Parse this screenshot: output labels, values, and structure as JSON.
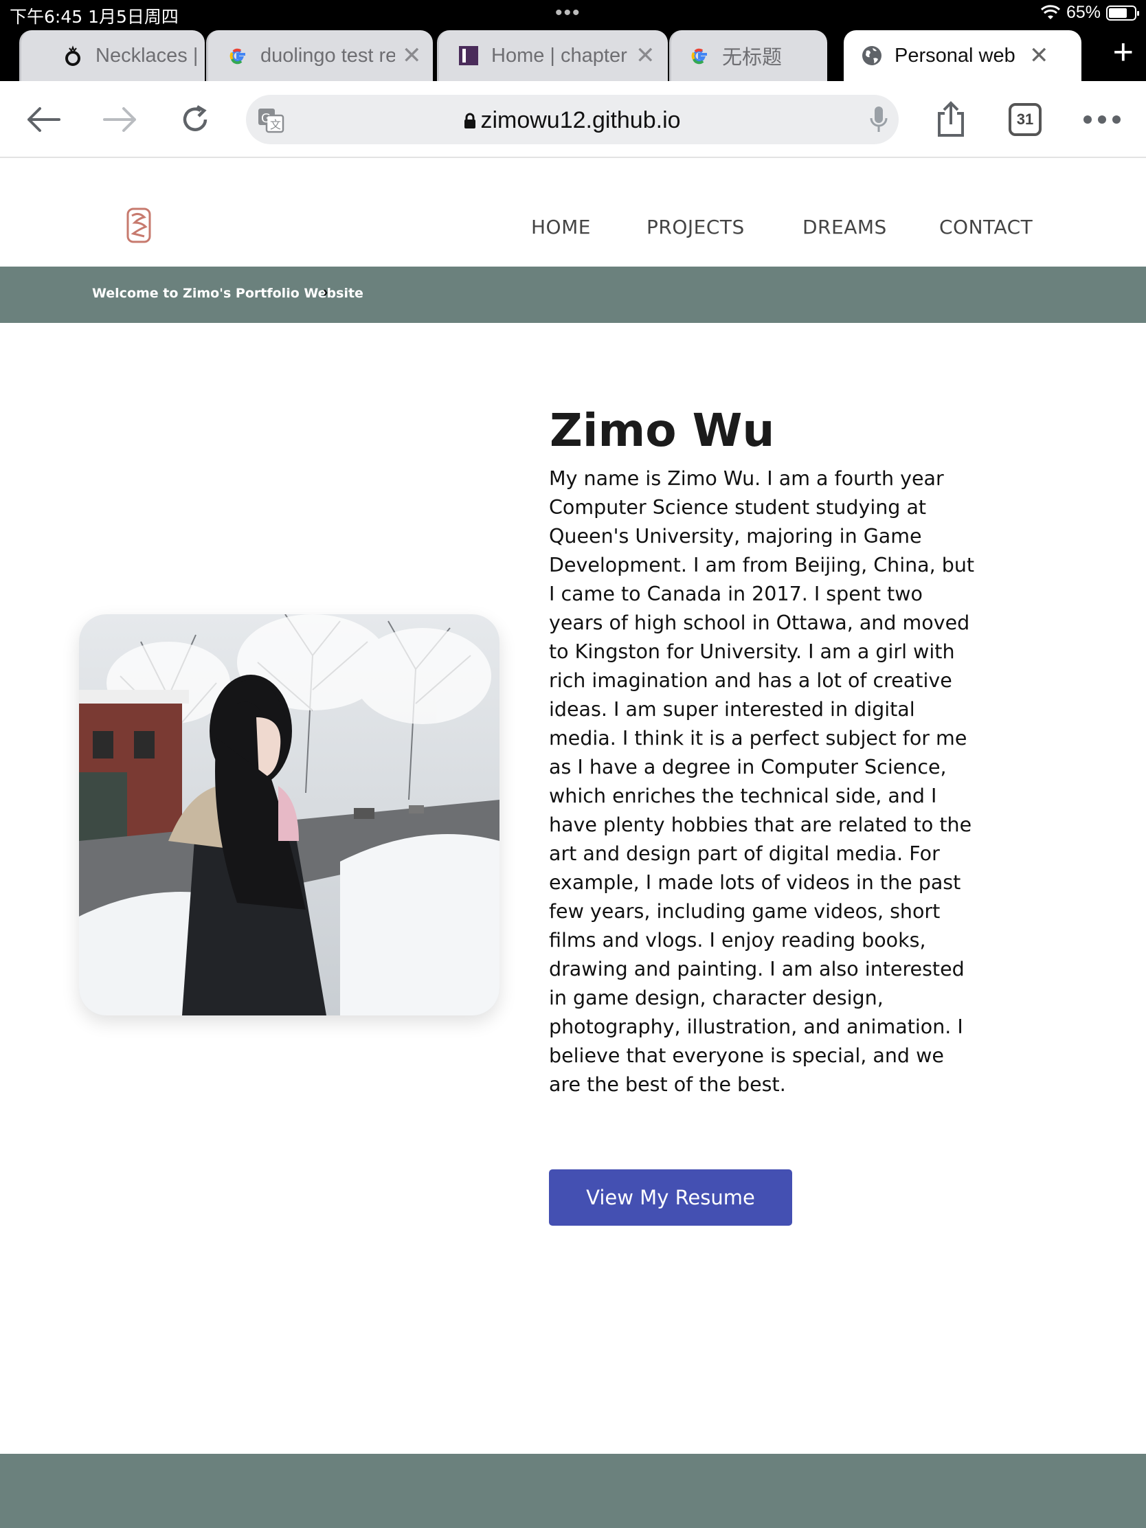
{
  "status_bar": {
    "time": "下午6:45   1月5日周四",
    "battery": "65%"
  },
  "tabs": [
    {
      "title": "Necklaces | I",
      "icon": "necklace-favicon"
    },
    {
      "title": "duolingo test re",
      "icon": "google-favicon"
    },
    {
      "title": "Home | chapter",
      "icon": "chapters-favicon"
    },
    {
      "title": "无标题",
      "icon": "google-favicon"
    },
    {
      "title": "Personal web",
      "icon": "globe-favicon",
      "active": true
    }
  ],
  "toolbar": {
    "url": "zimowu12.github.io",
    "tab_count": "31"
  },
  "site": {
    "nav": [
      "HOME",
      "PROJECTS",
      "DREAMS",
      "CONTACT"
    ],
    "banner": "Welcome to Zimo's Portfolio Website",
    "name": "Zimo Wu",
    "bio": "My name is Zimo Wu. I am a fourth year Computer Science student studying at Queen's University, majoring in Game Development. I am from Beijing, China, but I came to Canada in 2017. I spent two years of high school in Ottawa, and moved to Kingston for University. I am a girl with rich imagination and has a lot of creative ideas. I am super interested in digital media. I think it is a perfect subject for me as I have a degree in Computer Science, which enriches the technical side, and I have plenty hobbies that are related to the art and design part of digital media. For example, I made lots of videos in the past few years, including game videos, short films and vlogs. I enjoy reading books, drawing and painting. I am also interested in game design, character design, photography, illustration, and animation. I believe that everyone is special, and we are the best of the best.",
    "resume_button": "View My Resume"
  },
  "colors": {
    "banner": "#6b817d",
    "button": "#4450b2",
    "logo": "#c77a6e"
  }
}
